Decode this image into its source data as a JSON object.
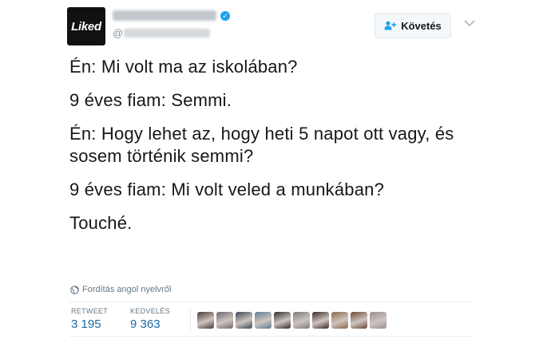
{
  "profile": {
    "avatar_text": "Liked",
    "display_name_blurred": true,
    "handle_prefix": "@",
    "verified": true
  },
  "follow_button": {
    "label": "Követés",
    "icon": "add-user-icon"
  },
  "menu_icon": "chevron-down-icon",
  "tweet": {
    "paragraphs": [
      "Én: Mi volt ma az iskolában?",
      "9 éves fiam: Semmi.",
      "Én: Hogy lehet az, hogy heti 5 napot ott vagy, és sosem történik semmi?",
      "9 éves fiam: Mi volt veled a munkában?",
      "Touché."
    ]
  },
  "translate": {
    "label": "Fordítás angol nyelvről",
    "icon": "globe-icon"
  },
  "stats": {
    "retweets": {
      "label": "RETWEET",
      "value": "3 195"
    },
    "likes": {
      "label": "KEDVELÉS",
      "value": "9 363"
    }
  },
  "likers": [
    {
      "color": "#4a3a38"
    },
    {
      "color": "#6d6a72"
    },
    {
      "color": "#3c4a5a"
    },
    {
      "color": "#5f7d96"
    },
    {
      "color": "#2d2d2d"
    },
    {
      "color": "#7b7b7b"
    },
    {
      "color": "#3a2b2a"
    },
    {
      "color": "#8a6a4a"
    },
    {
      "color": "#6a4a3a"
    },
    {
      "color": "#9a8c94"
    }
  ],
  "colors": {
    "link": "#1b6aa5",
    "verified": "#1da1f2",
    "muted": "#657786"
  }
}
